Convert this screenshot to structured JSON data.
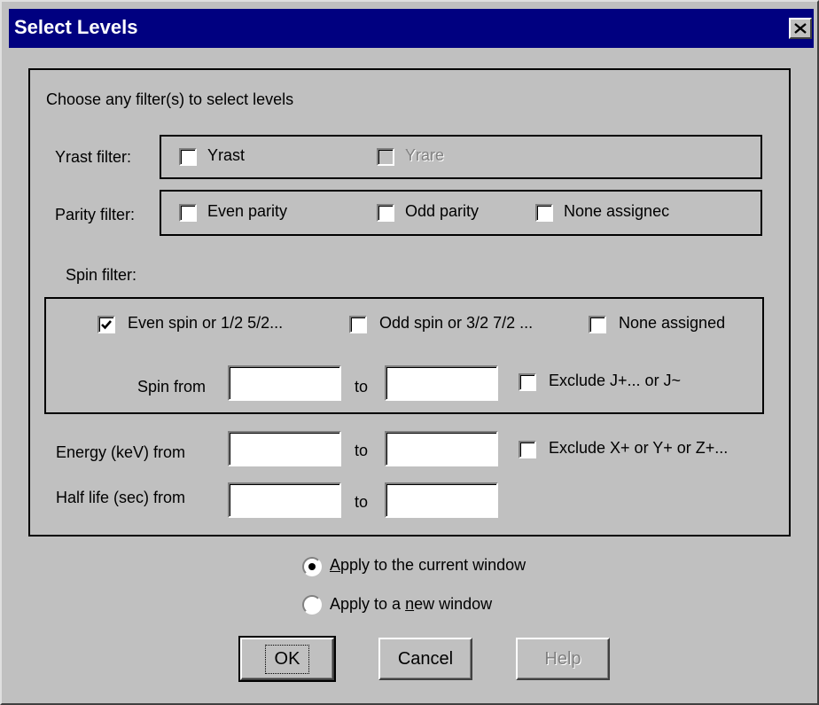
{
  "window": {
    "title": "Select Levels",
    "close_glyph": "close-icon"
  },
  "instructions": "Choose any filter(s) to select levels",
  "yrast": {
    "label": "Yrast filter:",
    "options": [
      {
        "label": "Yrast",
        "checked": false,
        "disabled": false
      },
      {
        "label": "Yrare",
        "checked": false,
        "disabled": true
      }
    ]
  },
  "parity": {
    "label": "Parity filter:",
    "options": [
      {
        "label": "Even parity",
        "checked": false
      },
      {
        "label": "Odd parity",
        "checked": false
      },
      {
        "label": "None assignec",
        "checked": false
      }
    ]
  },
  "spin": {
    "label": "Spin filter:",
    "options": [
      {
        "label": "Even spin or 1/2 5/2...",
        "checked": true
      },
      {
        "label": "Odd spin or 3/2 7/2 ...",
        "checked": false
      },
      {
        "label": "None assigned",
        "checked": false
      }
    ],
    "from_label": "Spin from",
    "to_label": "to",
    "from_value": "",
    "to_value": "",
    "exclude_label": "Exclude J+... or J~",
    "exclude_checked": false
  },
  "energy": {
    "from_label": "Energy (keV) from",
    "to_label": "to",
    "from_value": "",
    "to_value": "",
    "exclude_label": "Exclude X+ or Y+ or Z+...",
    "exclude_checked": false
  },
  "halflife": {
    "from_label": "Half life (sec)  from",
    "to_label": "to",
    "from_value": "",
    "to_value": ""
  },
  "apply": {
    "current": {
      "prefix": "",
      "accel": "A",
      "rest": "pply to the current window",
      "selected": true
    },
    "new": {
      "prefix": "Apply to a ",
      "accel": "n",
      "rest": "ew window",
      "selected": false
    }
  },
  "buttons": {
    "ok": "OK",
    "cancel": "Cancel",
    "help": "Help"
  },
  "colors": {
    "title_bar": "#000080",
    "face": "#c0c0c0",
    "disabled_text": "#808080"
  }
}
